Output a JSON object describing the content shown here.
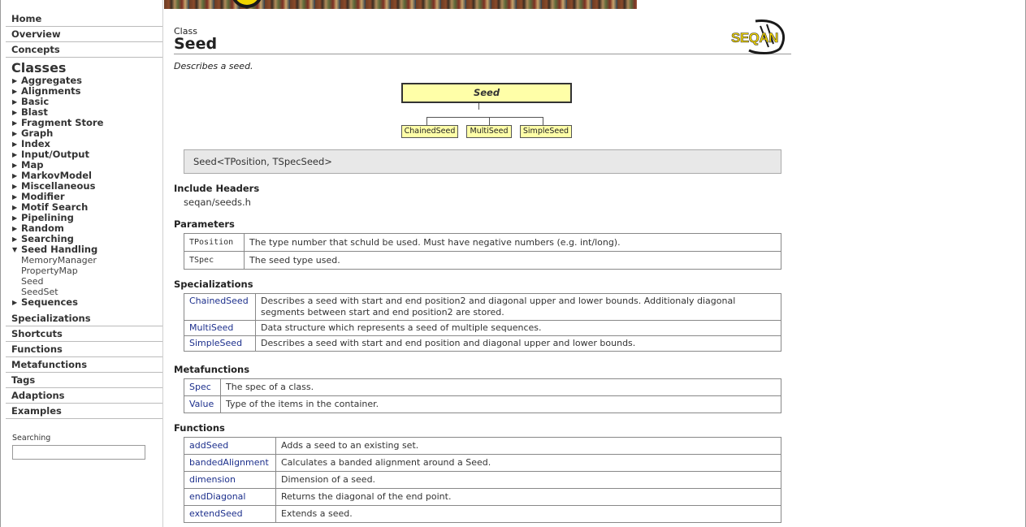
{
  "sidebar": {
    "top_links": [
      "Home",
      "Overview",
      "Concepts"
    ],
    "classes_heading": "Classes",
    "categories": [
      {
        "label": "Aggregates",
        "expanded": false
      },
      {
        "label": "Alignments",
        "expanded": false
      },
      {
        "label": "Basic",
        "expanded": false
      },
      {
        "label": "Blast",
        "expanded": false
      },
      {
        "label": "Fragment Store",
        "expanded": false
      },
      {
        "label": "Graph",
        "expanded": false
      },
      {
        "label": "Index",
        "expanded": false
      },
      {
        "label": "Input/Output",
        "expanded": false
      },
      {
        "label": "Map",
        "expanded": false
      },
      {
        "label": "MarkovModel",
        "expanded": false
      },
      {
        "label": "Miscellaneous",
        "expanded": false
      },
      {
        "label": "Modifier",
        "expanded": false
      },
      {
        "label": "Motif Search",
        "expanded": false
      },
      {
        "label": "Pipelining",
        "expanded": false
      },
      {
        "label": "Random",
        "expanded": false
      },
      {
        "label": "Searching",
        "expanded": false
      },
      {
        "label": "Seed Handling",
        "expanded": true
      },
      {
        "label": "Sequences",
        "expanded": false
      }
    ],
    "seed_handling_items": [
      "MemoryManager",
      "PropertyMap",
      "Seed",
      "SeedSet"
    ],
    "bottom_links": [
      "Specializations",
      "Shortcuts",
      "Functions",
      "Metafunctions",
      "Tags",
      "Adaptions",
      "Examples"
    ],
    "search_label": "Searching",
    "search_value": ""
  },
  "page": {
    "kind": "Class",
    "title": "Seed",
    "description": "Describes a seed.",
    "logo_text": "SEQAN",
    "diagram": {
      "parent": "Seed",
      "children": [
        "ChainedSeed",
        "MultiSeed",
        "SimpleSeed"
      ]
    },
    "signature": "Seed<TPosition, TSpecSeed>",
    "include_headers_title": "Include Headers",
    "include_header": "seqan/seeds.h",
    "parameters_title": "Parameters",
    "parameters": [
      {
        "name": "TPosition",
        "desc": "The type number that schuld be used. Must have negative numbers (e.g. int/long)."
      },
      {
        "name": "TSpec",
        "desc": "The seed type used."
      }
    ],
    "specializations_title": "Specializations",
    "specializations": [
      {
        "name": "ChainedSeed",
        "desc": "Describes a seed with start and end position2 and diagonal upper and lower bounds. Additionaly diagonal segments between start and end position2 are stored."
      },
      {
        "name": "MultiSeed",
        "desc": "Data structure which represents a seed of multiple sequences."
      },
      {
        "name": "SimpleSeed",
        "desc": "Describes a seed with start and end position and diagonal upper and lower bounds."
      }
    ],
    "metafunctions_title": "Metafunctions",
    "metafunctions": [
      {
        "name": "Spec",
        "desc": "The spec of a class."
      },
      {
        "name": "Value",
        "desc": "Type of the items in the container."
      }
    ],
    "functions_title": "Functions",
    "functions": [
      {
        "name": "addSeed",
        "desc": "Adds a seed to an existing set."
      },
      {
        "name": "bandedAlignment",
        "desc": "Calculates a banded alignment around a Seed."
      },
      {
        "name": "dimension",
        "desc": "Dimension of a seed."
      },
      {
        "name": "endDiagonal",
        "desc": "Returns the diagonal of the end point."
      },
      {
        "name": "extendSeed",
        "desc": "Extends a seed."
      }
    ]
  }
}
